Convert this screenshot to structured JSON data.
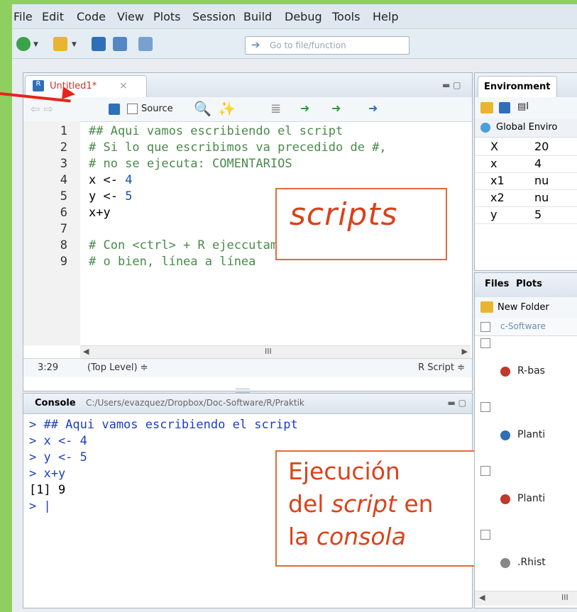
{
  "menu": [
    "File",
    "Edit",
    "Code",
    "View",
    "Plots",
    "Session",
    "Build",
    "Debug",
    "Tools",
    "Help"
  ],
  "toolbar": {
    "goto_placeholder": "Go to file/function"
  },
  "editor": {
    "tab_title": "Untitled1*",
    "tab_close": "×",
    "source_label": "Source",
    "lines": [
      {
        "n": "1",
        "segments": [
          {
            "t": "## Aqui vamos escribiendo el script",
            "c": "com"
          }
        ]
      },
      {
        "n": "2",
        "segments": [
          {
            "t": "# Si lo que escribimos va precedido de #,",
            "c": "com"
          }
        ]
      },
      {
        "n": "3",
        "segments": [
          {
            "t": "# no se ejecuta: COMENTARIOS",
            "c": "com"
          }
        ]
      },
      {
        "n": "4",
        "segments": [
          {
            "t": "x <- ",
            "c": "def"
          },
          {
            "t": "4",
            "c": "num"
          }
        ]
      },
      {
        "n": "5",
        "segments": [
          {
            "t": "y <- ",
            "c": "def"
          },
          {
            "t": "5",
            "c": "num"
          }
        ]
      },
      {
        "n": "6",
        "segments": [
          {
            "t": "x+y",
            "c": "def"
          }
        ]
      },
      {
        "n": "7",
        "segments": [
          {
            "t": "",
            "c": "def"
          }
        ]
      },
      {
        "n": "8",
        "segments": [
          {
            "t": "# Con <ctrl> + R ejeccutamos todo el código",
            "c": "com"
          }
        ]
      },
      {
        "n": "9",
        "segments": [
          {
            "t": "# o bien, línea a línea",
            "c": "com"
          }
        ]
      }
    ],
    "status_position": "3:29",
    "status_scope": "(Top Level) ≑",
    "status_type": "R Script ≑",
    "annotation": "scripts"
  },
  "console": {
    "title": "Console",
    "path": "C:/Users/evazquez/Dropbox/Doc-Software/R/Praktik",
    "lines": [
      "> ## Aqui vamos escribiendo el script",
      "> x <- 4",
      "> y <- 5",
      "> x+y",
      "[1] 9",
      "> |"
    ],
    "annotation": {
      "line1": "Ejecución",
      "line2a": "del ",
      "line2b": "script",
      "line2c": " en",
      "line3a": "la ",
      "line3b": "consola"
    }
  },
  "environment": {
    "tab": "Environment",
    "scope": "Global Enviro",
    "import_label": "I",
    "rows": [
      {
        "name": "X",
        "value": "20"
      },
      {
        "name": "x",
        "value": "4"
      },
      {
        "name": "x1",
        "value": "nu"
      },
      {
        "name": "x2",
        "value": "nu"
      },
      {
        "name": "y",
        "value": "5"
      }
    ]
  },
  "files": {
    "tabs": [
      "Files",
      "Plots"
    ],
    "new_folder": "New Folder",
    "breadcrumb": "c-Software",
    "items": [
      "R-bas",
      "Planti",
      "Planti",
      ".Rhist"
    ],
    "scroll_mark": "III"
  },
  "colors": {
    "annotation": "#d9431a",
    "arrow": "#e8241a",
    "background": "#8fcf5f"
  }
}
